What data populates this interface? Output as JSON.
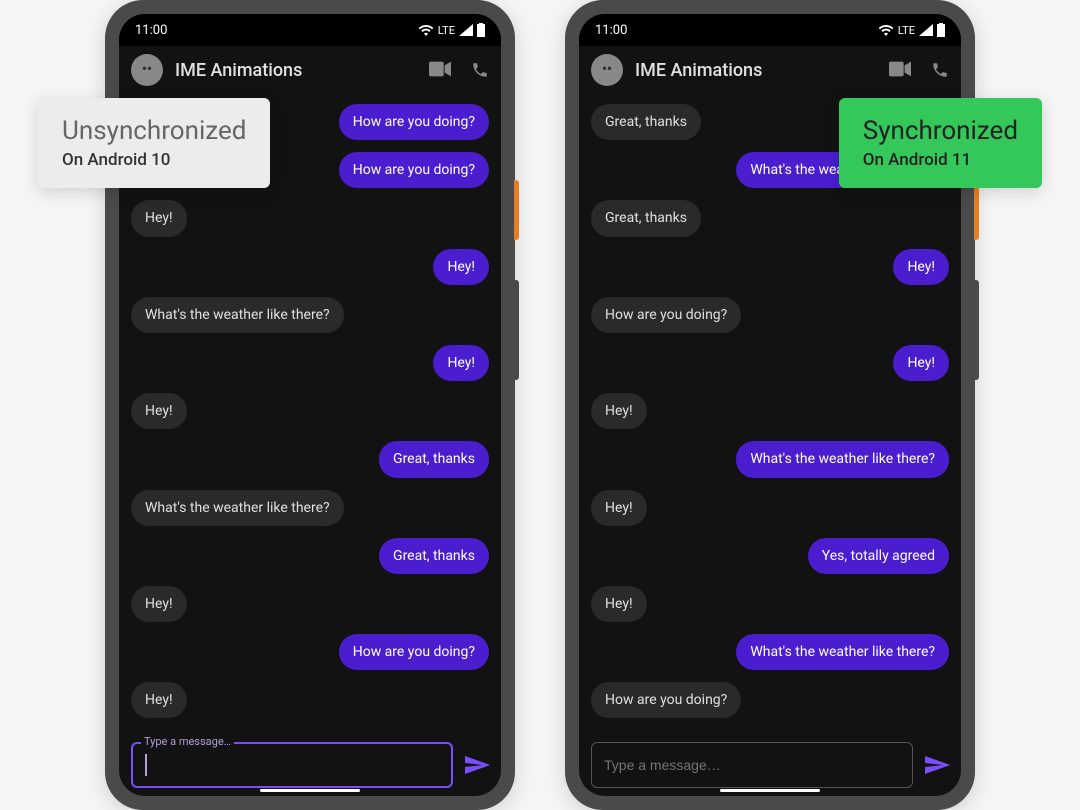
{
  "status": {
    "time": "11:00",
    "network": "LTE"
  },
  "app": {
    "title": "IME Animations"
  },
  "composer": {
    "placeholder": "Type a message…"
  },
  "tags": {
    "left": {
      "title": "Unsynchronized",
      "sub": "On Android 10"
    },
    "right": {
      "title": "Synchronized",
      "sub": "On Android 11"
    }
  },
  "phoneA": {
    "msgs": [
      {
        "side": "mine",
        "text": "How are you doing?"
      },
      {
        "side": "mine",
        "text": "How are you doing?"
      },
      {
        "side": "other",
        "text": "Hey!"
      },
      {
        "side": "mine",
        "text": "Hey!"
      },
      {
        "side": "other",
        "text": "What's the weather like there?"
      },
      {
        "side": "mine",
        "text": "Hey!"
      },
      {
        "side": "other",
        "text": "Hey!"
      },
      {
        "side": "mine",
        "text": "Great, thanks"
      },
      {
        "side": "other",
        "text": "What's the weather like there?"
      },
      {
        "side": "mine",
        "text": "Great, thanks"
      },
      {
        "side": "other",
        "text": "Hey!"
      },
      {
        "side": "mine",
        "text": "How are you doing?"
      },
      {
        "side": "other",
        "text": "Hey!"
      }
    ]
  },
  "phoneB": {
    "msgs": [
      {
        "side": "other",
        "text": "Great, thanks"
      },
      {
        "side": "mine",
        "text": "What's the weather like there?"
      },
      {
        "side": "other",
        "text": "Great, thanks"
      },
      {
        "side": "mine",
        "text": "Hey!"
      },
      {
        "side": "other",
        "text": "How are you doing?"
      },
      {
        "side": "mine",
        "text": "Hey!"
      },
      {
        "side": "other",
        "text": "Hey!"
      },
      {
        "side": "mine",
        "text": "What's the weather like there?"
      },
      {
        "side": "other",
        "text": "Hey!"
      },
      {
        "side": "mine",
        "text": "Yes, totally agreed"
      },
      {
        "side": "other",
        "text": "Hey!"
      },
      {
        "side": "mine",
        "text": "What's the weather like there?"
      },
      {
        "side": "other",
        "text": "How are you doing?"
      }
    ]
  }
}
